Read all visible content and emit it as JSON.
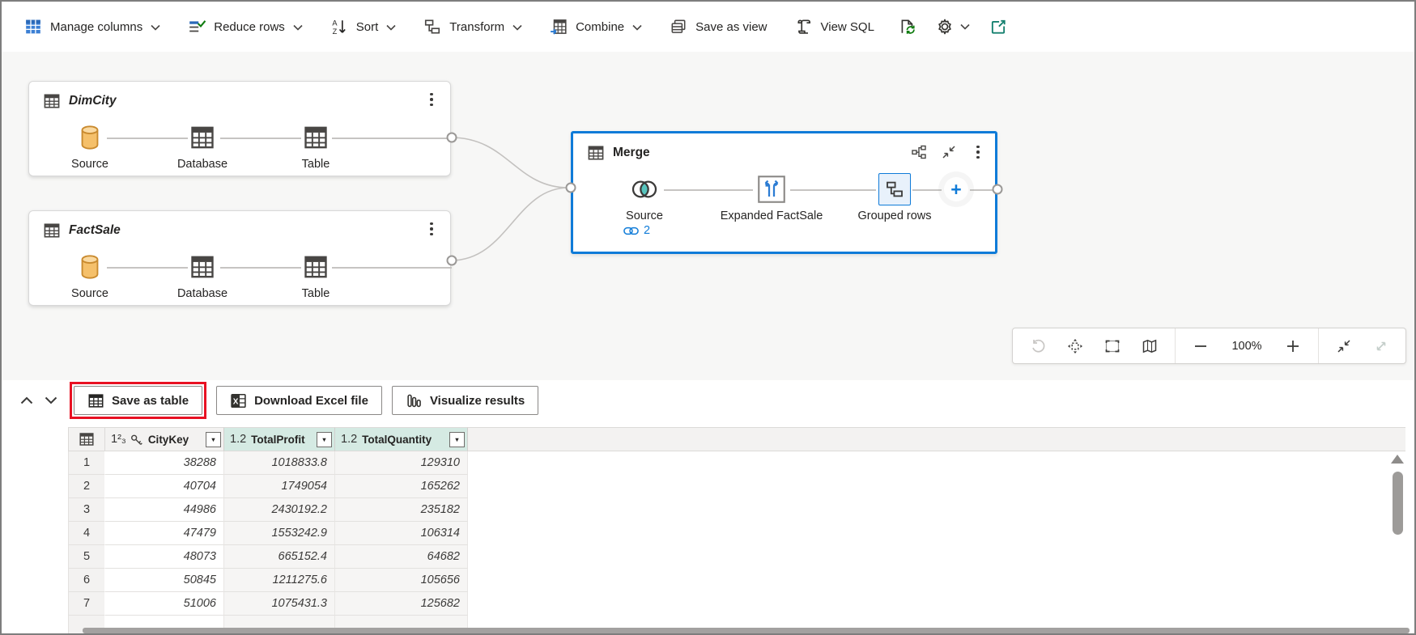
{
  "toolbar": {
    "items": [
      {
        "name": "manage-columns",
        "label": "Manage columns",
        "icon": "manage-columns-icon",
        "dropdown": true
      },
      {
        "name": "reduce-rows",
        "label": "Reduce rows",
        "icon": "reduce-rows-icon",
        "dropdown": true
      },
      {
        "name": "sort",
        "label": "Sort",
        "icon": "sort-az-icon",
        "dropdown": true
      },
      {
        "name": "transform",
        "label": "Transform",
        "icon": "transform-icon",
        "dropdown": true
      },
      {
        "name": "combine",
        "label": "Combine",
        "icon": "combine-icon",
        "dropdown": true
      },
      {
        "name": "save-as-view",
        "label": "Save as view",
        "icon": "save-as-view-icon",
        "dropdown": false
      },
      {
        "name": "view-sql",
        "label": "View SQL",
        "icon": "view-sql-icon",
        "dropdown": false
      }
    ],
    "icon_buttons": [
      {
        "name": "refresh-script",
        "icon": "refresh-doc-icon",
        "dropdown": false
      },
      {
        "name": "settings",
        "icon": "gear-icon",
        "dropdown": true
      },
      {
        "name": "open-external",
        "icon": "open-external-icon",
        "dropdown": false
      }
    ]
  },
  "diagram": {
    "queries": [
      {
        "name": "DimCity",
        "steps": [
          "Source",
          "Database",
          "Table"
        ]
      },
      {
        "name": "FactSale",
        "steps": [
          "Source",
          "Database",
          "Table"
        ]
      }
    ],
    "merge": {
      "name": "Merge",
      "steps": [
        "Source",
        "Expanded FactSale",
        "Grouped rows"
      ],
      "selected_step": "Grouped rows",
      "link_count": "2"
    }
  },
  "zoom_toolbar": {
    "zoom_level": "100%"
  },
  "results": {
    "buttons": {
      "save_as_table": "Save as table",
      "download_excel": "Download Excel file",
      "visualize": "Visualize results"
    },
    "grid": {
      "columns": [
        {
          "name": "CityKey",
          "type_label": "1²₃",
          "key": true,
          "selected": false
        },
        {
          "name": "TotalProfit",
          "type_label": "1.2",
          "key": false,
          "selected": true
        },
        {
          "name": "TotalQuantity",
          "type_label": "1.2",
          "key": false,
          "selected": true
        }
      ],
      "rows": [
        [
          "38288",
          "1018833.8",
          "129310"
        ],
        [
          "40704",
          "1749054",
          "165262"
        ],
        [
          "44986",
          "2430192.2",
          "235182"
        ],
        [
          "47479",
          "1553242.9",
          "106314"
        ],
        [
          "48073",
          "665152.4",
          "64682"
        ],
        [
          "50845",
          "1211275.6",
          "105656"
        ],
        [
          "51006",
          "1075431.3",
          "125682"
        ]
      ]
    }
  },
  "colors": {
    "accent": "#0f7bd8",
    "highlight_red": "#e81123",
    "selected_column_bg": "#d5eae3",
    "source_orange": "#f5c06a"
  }
}
